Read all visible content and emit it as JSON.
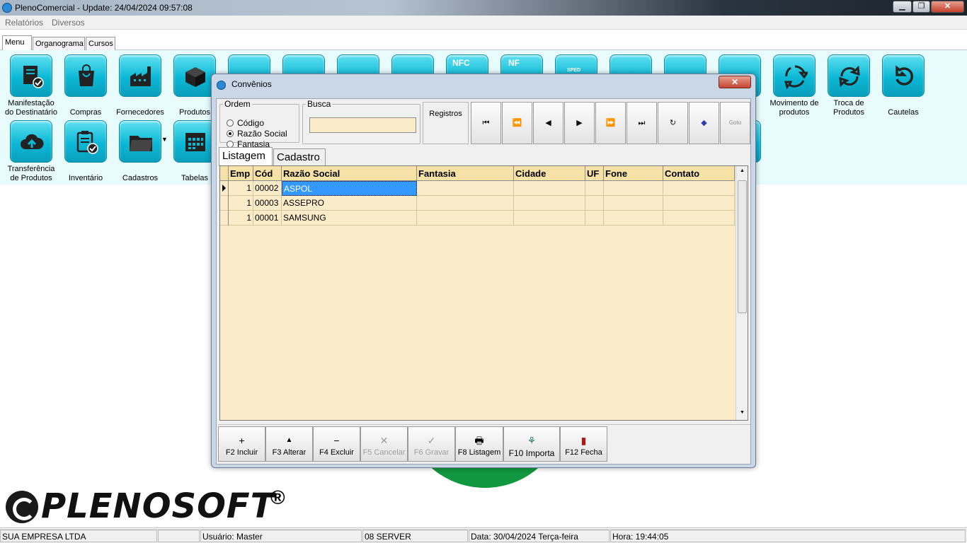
{
  "window": {
    "title": "PlenoComercial - Update: 24/04/2024 09:57:08",
    "minimize": "▁",
    "restore": "❐",
    "close": "✕"
  },
  "menubar": [
    "Relatórios",
    "Diversos"
  ],
  "tabs": [
    "Menu",
    "Organograma",
    "Cursos"
  ],
  "tiles_row1": [
    {
      "label": "Manifestação do Destinatário",
      "icon": "document-check-icon"
    },
    {
      "label": "Compras",
      "icon": "shopping-bag-icon"
    },
    {
      "label": "Fornecedores",
      "icon": "factory-icon"
    },
    {
      "label": "Produtos",
      "icon": "box-icon"
    },
    {
      "label": "Movimento de produtos",
      "icon": "cycle-arrows-icon"
    },
    {
      "label": "Troca de Produtos",
      "icon": "swap-arrows-icon"
    },
    {
      "label": "Cautelas",
      "icon": "refresh-arrow-icon"
    }
  ],
  "tiles_row2": [
    {
      "label": "Transferência de Produtos",
      "icon": "cloud-upload-icon"
    },
    {
      "label": "Inventário",
      "icon": "clipboard-check-icon"
    },
    {
      "label": "Cadastros",
      "icon": "folder-icon"
    },
    {
      "label": "Tabelas",
      "icon": "calendar-grid-icon"
    }
  ],
  "hidden_tile_badges": [
    "NFC",
    "NF",
    "SPED"
  ],
  "logo": {
    "text": "PLENOSOFT",
    "mark": "®"
  },
  "status": {
    "company": "SUA EMPRESA LTDA",
    "user": "Usuário: Master",
    "server": "08 SERVER",
    "date": "Data: 30/04/2024 Terça-feira",
    "time": "Hora: 19:44:05"
  },
  "dialog": {
    "title": "Convênios",
    "close": "✕",
    "ordem": {
      "legend": "Ordem",
      "options": [
        "Código",
        "Razão Social",
        "Fantasia"
      ],
      "selected": "Razão Social"
    },
    "busca": {
      "legend": "Busca",
      "value": ""
    },
    "registros_label": "Registros",
    "nav_buttons": [
      {
        "name": "first-record",
        "glyph": "⏮"
      },
      {
        "name": "prior-page",
        "glyph": "⏪"
      },
      {
        "name": "prior-record",
        "glyph": "◀"
      },
      {
        "name": "next-record",
        "glyph": "▶"
      },
      {
        "name": "next-page",
        "glyph": "⏩"
      },
      {
        "name": "last-record",
        "glyph": "⏭"
      },
      {
        "name": "refresh",
        "glyph": "↻"
      },
      {
        "name": "bookmark",
        "glyph": "◆"
      },
      {
        "name": "goto",
        "glyph": "Goto"
      }
    ],
    "inner_tabs": [
      "Listagem",
      "Cadastro"
    ],
    "grid": {
      "columns": [
        "Emp",
        "Cód",
        "Razão Social",
        "Fantasia",
        "Cidade",
        "UF",
        "Fone",
        "Contato"
      ],
      "rows": [
        {
          "emp": "1",
          "cod": "00002",
          "razao": "ASPOL",
          "fantasia": "",
          "cidade": "",
          "uf": "",
          "fone": "",
          "contato": ""
        },
        {
          "emp": "1",
          "cod": "00003",
          "razao": "ASSEPRO",
          "fantasia": "",
          "cidade": "",
          "uf": "",
          "fone": "",
          "contato": ""
        },
        {
          "emp": "1",
          "cod": "00001",
          "razao": "SAMSUNG",
          "fantasia": "",
          "cidade": "",
          "uf": "",
          "fone": "",
          "contato": ""
        }
      ]
    },
    "toolbar": [
      {
        "label": "F2 Incluir",
        "glyph": "+",
        "enabled": true
      },
      {
        "label": "F3 Alterar",
        "glyph": "▲",
        "enabled": true
      },
      {
        "label": "F4 Excluir",
        "glyph": "−",
        "enabled": true
      },
      {
        "label": "F5 Cancelar",
        "glyph": "✕",
        "enabled": false
      },
      {
        "label": "F6 Gravar",
        "glyph": "✓",
        "enabled": false
      },
      {
        "label": "F8 Listagem",
        "glyph": "🖶",
        "enabled": true
      },
      {
        "label": "F10 Importa",
        "glyph": "⚘",
        "enabled": true
      },
      {
        "label": "F12 Fecha",
        "glyph": "▮",
        "enabled": true
      }
    ]
  }
}
